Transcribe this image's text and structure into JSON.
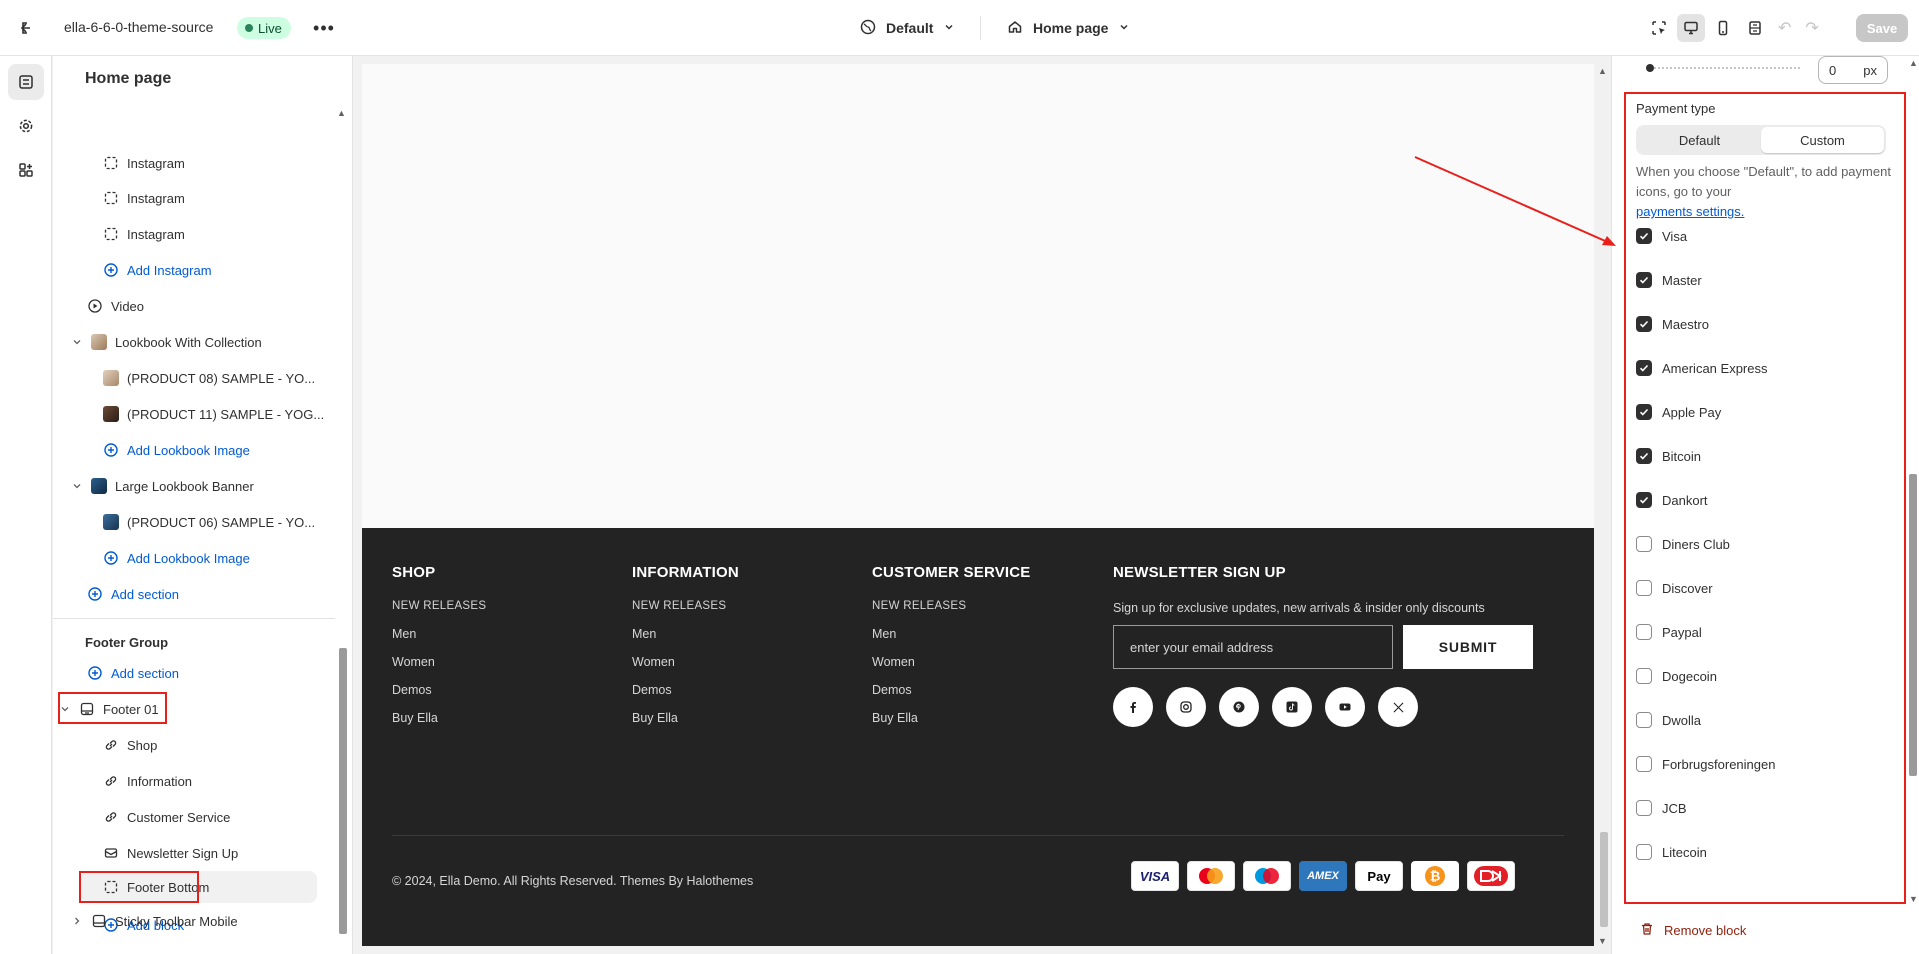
{
  "topbar": {
    "store_name": "ella-6-6-0-theme-source",
    "status": "Live",
    "theme": "Default",
    "page": "Home page",
    "save_label": "Save"
  },
  "sidebar": {
    "title": "Home page",
    "items": [
      {
        "label": "Instagram"
      },
      {
        "label": "Instagram"
      },
      {
        "label": "Instagram"
      },
      {
        "label": "Add Instagram"
      },
      {
        "label": "Video"
      },
      {
        "label": "Lookbook With Collection"
      },
      {
        "label": "(PRODUCT 08) SAMPLE - YO..."
      },
      {
        "label": "(PRODUCT 11) SAMPLE - YOG..."
      },
      {
        "label": "Add Lookbook Image"
      },
      {
        "label": "Large Lookbook Banner"
      },
      {
        "label": "(PRODUCT 06) SAMPLE - YO..."
      },
      {
        "label": "Add Lookbook Image"
      },
      {
        "label": "Add section"
      }
    ],
    "footer_group": {
      "label": "Footer Group",
      "add_section": "Add section",
      "footer": "Footer 01",
      "blocks": [
        {
          "label": "Shop"
        },
        {
          "label": "Information"
        },
        {
          "label": "Customer Service"
        },
        {
          "label": "Newsletter Sign Up"
        },
        {
          "label": "Footer Bottom"
        }
      ],
      "add_block": "Add block"
    },
    "sticky_toolbar": "Sticky Toolbar Mobile"
  },
  "preview": {
    "columns": [
      {
        "title": "SHOP",
        "links": [
          "NEW RELEASES",
          "Men",
          "Women",
          "Demos",
          "Buy Ella"
        ]
      },
      {
        "title": "INFORMATION",
        "links": [
          "NEW RELEASES",
          "Men",
          "Women",
          "Demos",
          "Buy Ella"
        ]
      },
      {
        "title": "CUSTOMER SERVICE",
        "links": [
          "NEW RELEASES",
          "Men",
          "Women",
          "Demos",
          "Buy Ella"
        ]
      }
    ],
    "newsletter": {
      "title": "NEWSLETTER SIGN UP",
      "description": "Sign up for exclusive updates, new arrivals & insider only discounts",
      "placeholder": "enter your email address",
      "submit": "SUBMIT"
    },
    "socials": [
      "facebook-icon",
      "instagram-icon",
      "pinterest-icon",
      "tiktok-icon",
      "youtube-icon",
      "x-icon"
    ],
    "copyright": "© 2024, Ella Demo. All Rights Reserved. Themes By Halothemes",
    "payment_icons": [
      "VISA",
      "Mastercard",
      "Maestro",
      "AMEX",
      "Apple Pay",
      "Bitcoin",
      "Dankort"
    ]
  },
  "settings": {
    "px_value": "0",
    "px_unit": "px",
    "payment_type_label": "Payment type",
    "segment": {
      "default": "Default",
      "custom": "Custom",
      "selected": "Custom"
    },
    "hint_text": "When you choose \"Default\", to add payment icons, go to your",
    "hint_link": "payments settings.",
    "options": [
      {
        "label": "Visa",
        "checked": true
      },
      {
        "label": "Master",
        "checked": true
      },
      {
        "label": "Maestro",
        "checked": true
      },
      {
        "label": "American Express",
        "checked": true
      },
      {
        "label": "Apple Pay",
        "checked": true
      },
      {
        "label": "Bitcoin",
        "checked": true
      },
      {
        "label": "Dankort",
        "checked": true
      },
      {
        "label": "Diners Club",
        "checked": false
      },
      {
        "label": "Discover",
        "checked": false
      },
      {
        "label": "Paypal",
        "checked": false
      },
      {
        "label": "Dogecoin",
        "checked": false
      },
      {
        "label": "Dwolla",
        "checked": false
      },
      {
        "label": "Forbrugsforeningen",
        "checked": false
      },
      {
        "label": "JCB",
        "checked": false
      },
      {
        "label": "Litecoin",
        "checked": false
      }
    ],
    "remove_block": "Remove block"
  },
  "colors": {
    "accent_link": "#005bd3",
    "annotation_red": "#e8201c",
    "footer_bg": "#232323",
    "live_badge": "#cdfee1"
  }
}
